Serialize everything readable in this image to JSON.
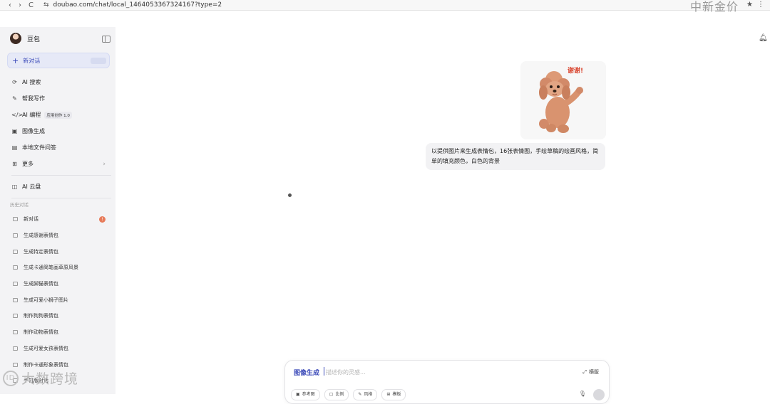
{
  "browser": {
    "back": "‹",
    "forward": "›",
    "reload": "C",
    "url": "doubao.com/chat/local_1464053367324167?type=2",
    "watermark": "中新金价",
    "star": "★",
    "menu": "⋮"
  },
  "sidebar": {
    "brand": "豆包",
    "new_chat": {
      "label": "新对话",
      "shortcut": ""
    },
    "items": [
      {
        "icon": "search-icon",
        "label": "AI 搜索"
      },
      {
        "icon": "pen-icon",
        "label": "帮我写作"
      },
      {
        "icon": "code-icon",
        "label": "AI 编程",
        "tag": "应用创作 1.0"
      },
      {
        "icon": "image-icon",
        "label": "图像生成"
      },
      {
        "icon": "file-icon",
        "label": "本地文件问答"
      },
      {
        "icon": "grid-icon",
        "label": "更多"
      },
      {
        "icon": "cloud-icon",
        "label": "AI 云盘"
      }
    ],
    "history_title": "历史对话",
    "history": [
      {
        "label": "新对话",
        "badge": "!"
      },
      {
        "label": "生成感谢表情包"
      },
      {
        "label": "生成特定表情包"
      },
      {
        "label": "生成卡通简笔画草原风景"
      },
      {
        "label": "生成脚猫表情包"
      },
      {
        "label": "生成可爱小狮子图片"
      },
      {
        "label": "制作狗狗表情包"
      },
      {
        "label": "制作动物表情包"
      },
      {
        "label": "生成可爱女孩表情包"
      },
      {
        "label": "制作卡通形象表情包"
      },
      {
        "label": "手机版对话"
      }
    ]
  },
  "watermark_bottom": {
    "logo": "ID",
    "text": "大数跨境"
  },
  "chat": {
    "sticker_text": "谢谢!",
    "user_message": "以提供图片来生成表情包，16张表情图，手绘草稿的绘画风格，简单的填充颜色，白色的背景"
  },
  "composer": {
    "mode": "图像生成",
    "placeholder": "描述你的灵感...",
    "ratio": "横版",
    "tools": [
      {
        "icon": "reference-image-icon",
        "label": "参考图"
      },
      {
        "icon": "ratio-icon",
        "label": "比例"
      },
      {
        "icon": "style-icon",
        "label": "风格"
      },
      {
        "icon": "template-icon",
        "label": "模板"
      }
    ]
  },
  "colors": {
    "accent": "#3a49b8",
    "sidebar_bg": "#f3f3f5",
    "bubble_bg": "#f2f2f4",
    "badge": "#e77b5a"
  }
}
